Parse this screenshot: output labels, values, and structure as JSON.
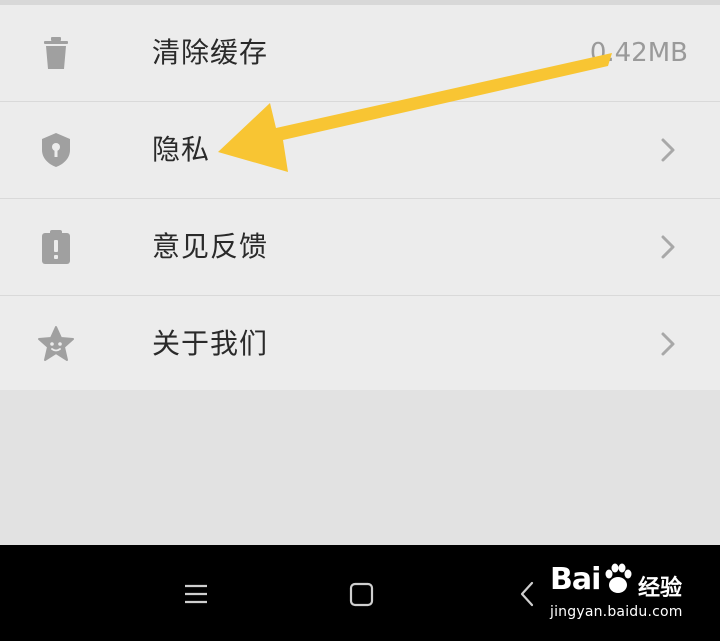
{
  "settings": {
    "items": [
      {
        "label": "清除缓存",
        "value": "0.42MB",
        "icon": "trash-icon"
      },
      {
        "label": "隐私",
        "icon": "shield-lock-icon",
        "has_chevron": true
      },
      {
        "label": "意见反馈",
        "icon": "feedback-clipboard-icon",
        "has_chevron": true
      },
      {
        "label": "关于我们",
        "icon": "star-face-icon",
        "has_chevron": true
      }
    ]
  },
  "annotation": {
    "arrow_color": "#f8c533"
  },
  "nav_bar": {
    "buttons": [
      "menu-icon",
      "home-square-icon",
      "back-icon"
    ]
  },
  "watermark": {
    "brand": "Bai",
    "brand_suffix": "经验",
    "url": "jingyan.baidu.com"
  },
  "colors": {
    "background": "#ececec",
    "icon_gray": "#a0a0a0",
    "nav_bar": "#000000"
  }
}
